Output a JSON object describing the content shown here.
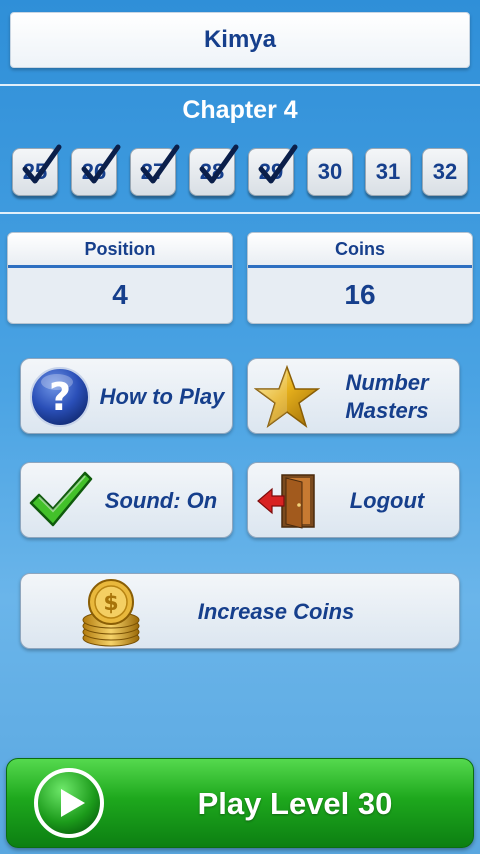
{
  "header": {
    "title": "Kimya"
  },
  "chapter": {
    "title": "Chapter 4",
    "levels": [
      {
        "number": "25",
        "completed": true
      },
      {
        "number": "26",
        "completed": true
      },
      {
        "number": "27",
        "completed": true
      },
      {
        "number": "28",
        "completed": true
      },
      {
        "number": "29",
        "completed": true
      },
      {
        "number": "30",
        "completed": false
      },
      {
        "number": "31",
        "completed": false
      },
      {
        "number": "32",
        "completed": false
      }
    ]
  },
  "stats": {
    "position_label": "Position",
    "position_value": "4",
    "coins_label": "Coins",
    "coins_value": "16"
  },
  "menu": {
    "how_to_play": {
      "label": "How to Play",
      "icon": "question-icon"
    },
    "number_masters": {
      "line1": "Number",
      "line2": "Masters",
      "icon": "star-icon"
    },
    "sound": {
      "label": "Sound: On",
      "icon": "checkmark-icon"
    },
    "logout": {
      "label": "Logout",
      "icon": "door-exit-icon"
    },
    "increase_coins": {
      "label": "Increase Coins",
      "icon": "coin-stack-icon"
    }
  },
  "play": {
    "label": "Play Level 30",
    "icon": "play-icon"
  },
  "colors": {
    "accent_text": "#163f8c",
    "play_green": "#1ea81d",
    "background_blue": "#4aa3e3"
  }
}
